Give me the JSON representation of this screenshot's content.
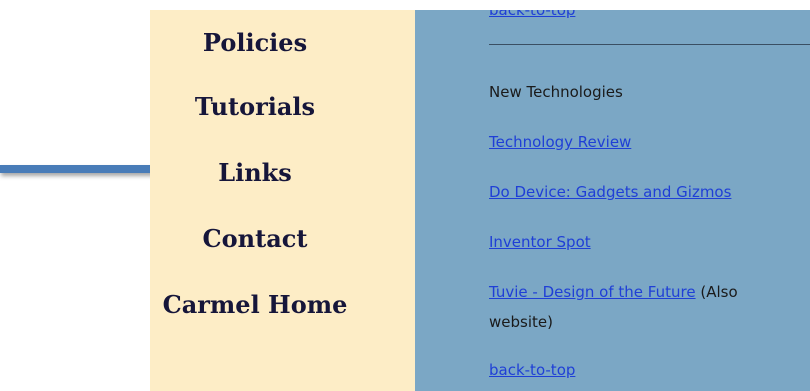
{
  "sidebar": {
    "items": [
      {
        "label": "Policies"
      },
      {
        "label": "Tutorials"
      },
      {
        "label": "Links"
      },
      {
        "label": "Contact"
      },
      {
        "label": "Carmel Home"
      }
    ]
  },
  "content": {
    "top_link": "back-to-top",
    "section_heading": "New Technologies",
    "links": [
      {
        "label": "Technology Review"
      },
      {
        "label": "Do Device: Gadgets and Gizmos"
      },
      {
        "label": "Inventor Spot"
      },
      {
        "label": "Tuvie - Design of the Future",
        "note": "(Also",
        "note_line2": "website)"
      }
    ],
    "bottom_link": "back-to-top"
  },
  "colors": {
    "sidebar_bg": "#fdedc6",
    "content_bg": "#7ba7c5",
    "link": "#1f3fd6",
    "arrow": "#4a7cb8"
  },
  "annotation": {
    "icon": "right-arrow-icon"
  }
}
